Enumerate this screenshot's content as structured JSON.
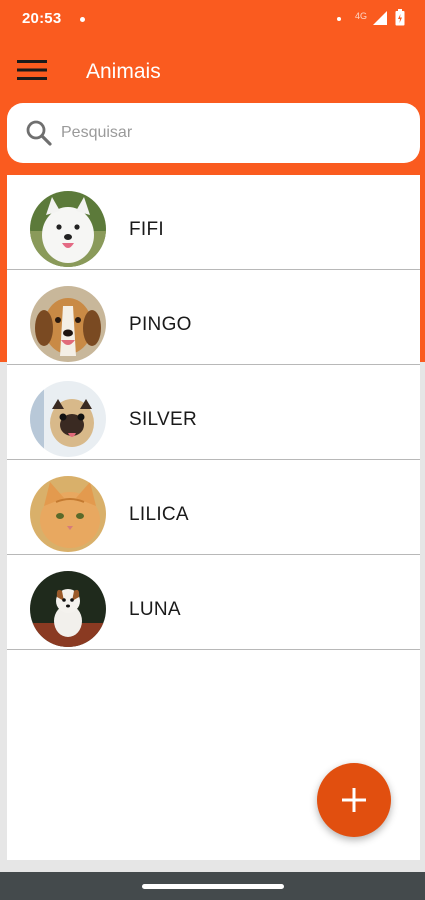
{
  "status_bar": {
    "time": "20:53",
    "network": "4G",
    "icons": [
      "notification-dot-icon",
      "signal-icon",
      "battery-icon"
    ]
  },
  "app_bar": {
    "title": "Animais",
    "menu_icon": "hamburger-menu-icon"
  },
  "search": {
    "placeholder": "Pesquisar",
    "value": "",
    "icon": "search-icon"
  },
  "animals": [
    {
      "name": "FIFI",
      "photo": "white-samoyed-dog"
    },
    {
      "name": "PINGO",
      "photo": "beagle-dog"
    },
    {
      "name": "SILVER",
      "photo": "pug-dog"
    },
    {
      "name": "LILICA",
      "photo": "orange-cat"
    },
    {
      "name": "LUNA",
      "photo": "jack-russell-puppy"
    }
  ],
  "fab": {
    "icon": "plus-icon"
  },
  "colors": {
    "primary": "#fa5b1f",
    "fab": "#e14f0f",
    "background": "#e6e6e6",
    "nav_bar": "#444a4c"
  }
}
